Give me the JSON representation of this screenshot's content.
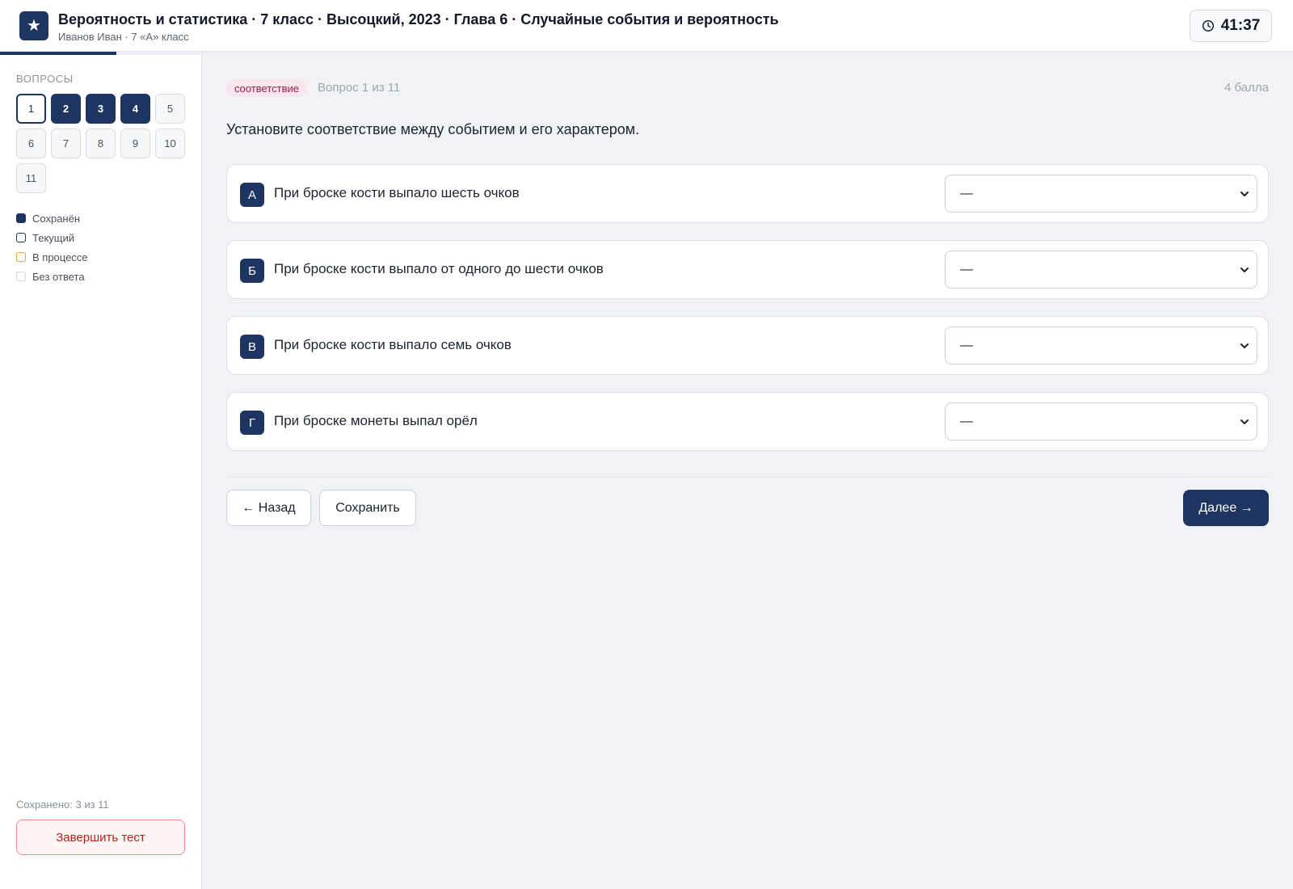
{
  "header": {
    "logo_glyph": "★",
    "title": "Вероятность и статистика · 7 класс · Высоцкий, 2023 · Глава 6 · Случайные события и вероятность",
    "subtitle": "Иванов Иван · 7 «А» класс",
    "timer": "41:37",
    "progress_fraction": 0.09
  },
  "sidebar": {
    "heading": "Вопросы",
    "questions": [
      {
        "n": "1",
        "state": "current"
      },
      {
        "n": "2",
        "state": "saved"
      },
      {
        "n": "3",
        "state": "saved"
      },
      {
        "n": "4",
        "state": "saved"
      },
      {
        "n": "5",
        "state": "empty"
      },
      {
        "n": "6",
        "state": "empty"
      },
      {
        "n": "7",
        "state": "empty"
      },
      {
        "n": "8",
        "state": "empty"
      },
      {
        "n": "9",
        "state": "empty"
      },
      {
        "n": "10",
        "state": "empty"
      },
      {
        "n": "11",
        "state": "empty"
      }
    ],
    "legend": {
      "saved": "Сохранён",
      "current": "Текущий",
      "in_progress": "В процессе",
      "no_answer": "Без ответа"
    },
    "saved_count": "Сохранено: 3 из 11",
    "finish_label": "Завершить тест"
  },
  "question": {
    "type_tag": "соответствие",
    "meta": "Вопрос 1 из 11",
    "points": "4 балла",
    "prompt": "Установите соответствие между событием и его характером.",
    "items": [
      {
        "letter": "А",
        "text": "При броске кости выпало шесть очков",
        "selected": "—"
      },
      {
        "letter": "Б",
        "text": "При броске кости выпало от одного до шести очков",
        "selected": "—"
      },
      {
        "letter": "В",
        "text": "При броске кости выпало семь очков",
        "selected": "—"
      },
      {
        "letter": "Г",
        "text": "При броске монеты выпал орёл",
        "selected": "—"
      }
    ]
  },
  "actions": {
    "back_label": "← Назад",
    "save_label": "Сохранить",
    "next_label": "Далее →"
  },
  "colors": {
    "accent": "#1e3461",
    "tag_bg": "#fbe6ee",
    "tag_text": "#9b1c47",
    "danger": "#b42318"
  }
}
